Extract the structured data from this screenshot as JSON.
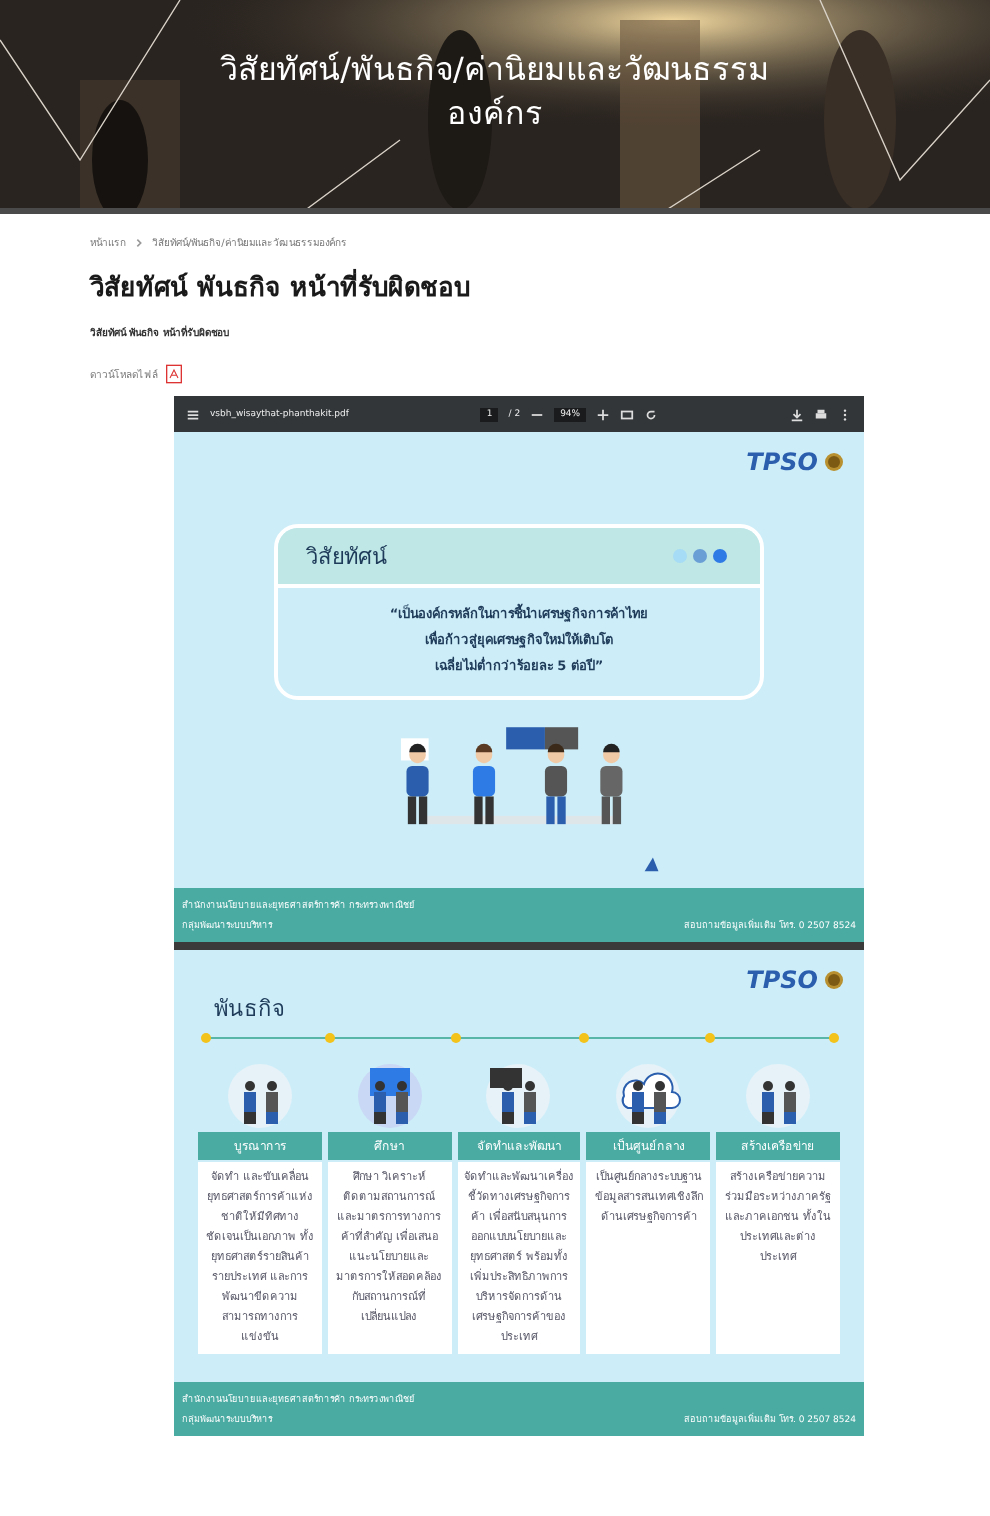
{
  "banner": {
    "kind": "picture",
    "title": "วิสัยทัศน์/พันธกิจ/ค่านิยมและวัฒนธรรมองค์กร"
  },
  "breadcrumb": [
    {
      "label": "หน้าแรก"
    },
    {
      "label": "วิสัยทัศน์/พันธกิจ/ค่านิยมและวัฒนธรรมองค์กร"
    }
  ],
  "heading": "วิสัยทัศน์ พันธกิจ หน้าที่รับผิดชอบ",
  "subtitle": "วิสัยทัศน์ พันธกิจ หน้าที่รับผิดชอบ",
  "download": {
    "label": "ดาวน์โหลดไฟล์"
  },
  "pdf_viewer": {
    "filename": "vsbh_wisaythat-phanthakit.pdf",
    "page": "1",
    "page_total": "/ 2",
    "zoom": "94%"
  },
  "slides": [
    {
      "kind": "vision",
      "logo": "TPSO",
      "card_title": "วิสัยทัศน์",
      "lines": [
        "“เป็นองค์กรหลักในการชี้นำเศรษฐกิจการค้าไทย",
        "เพื่อก้าวสู่ยุคเศรษฐกิจใหม่ให้เติบโต",
        "เฉลี่ยไม่ต่ำกว่าร้อยละ 5 ต่อปี”"
      ],
      "footer": {
        "office": "สำนักงานนโยบายและยุทธศาสตร์การค้า กระทรวงพาณิชย์",
        "group": "กลุ่มพัฒนาระบบบริหาร",
        "contact": "สอบถามข้อมูลเพิ่มเติม โทร. 0 2507 8524"
      }
    },
    {
      "kind": "mission",
      "logo": "TPSO",
      "title": "พันธกิจ",
      "items": [
        {
          "title": "บูรณาการ",
          "text": "จัดทำ และขับเคลื่อนยุทธศาสตร์การค้าแห่งชาติให้มีทิศทางชัดเจนเป็นเอกภาพ ทั้งยุทธศาสตร์รายสินค้า รายประเทศ และการพัฒนาขีดความสามารถทางการแข่งขัน"
        },
        {
          "title": "ศึกษา",
          "text": "ศึกษา วิเคราะห์ ติดตามสถานการณ์ และมาตรการทางการค้าที่สำคัญ เพื่อเสนอแนะนโยบายและมาตรการให้สอดคล้องกับสถานการณ์ที่เปลี่ยนแปลง"
        },
        {
          "title": "จัดทำและพัฒนา",
          "text": "จัดทำและพัฒนาเครื่องชี้วัดทางเศรษฐกิจการค้า เพื่อสนับสนุนการออกแบบนโยบายและยุทธศาสตร์ พร้อมทั้งเพิ่มประสิทธิภาพการบริหารจัดการด้านเศรษฐกิจการค้าของประเทศ"
        },
        {
          "title": "เป็นศูนย์กลาง",
          "text": "เป็นศูนย์กลางระบบฐานข้อมูลสารสนเทศเชิงลึกด้านเศรษฐกิจการค้า"
        },
        {
          "title": "สร้างเครือข่าย",
          "text": "สร้างเครือข่ายความร่วมมือระหว่างภาครัฐและภาคเอกชน ทั้งในประเทศและต่างประเทศ"
        }
      ],
      "footer": {
        "office": "สำนักงานนโยบายและยุทธศาสตร์การค้า กระทรวงพาณิชย์",
        "group": "กลุ่มพัฒนาระบบบริหาร",
        "contact": "สอบถามข้อมูลเพิ่มเติม โทร. 0 2507 8524"
      }
    }
  ]
}
